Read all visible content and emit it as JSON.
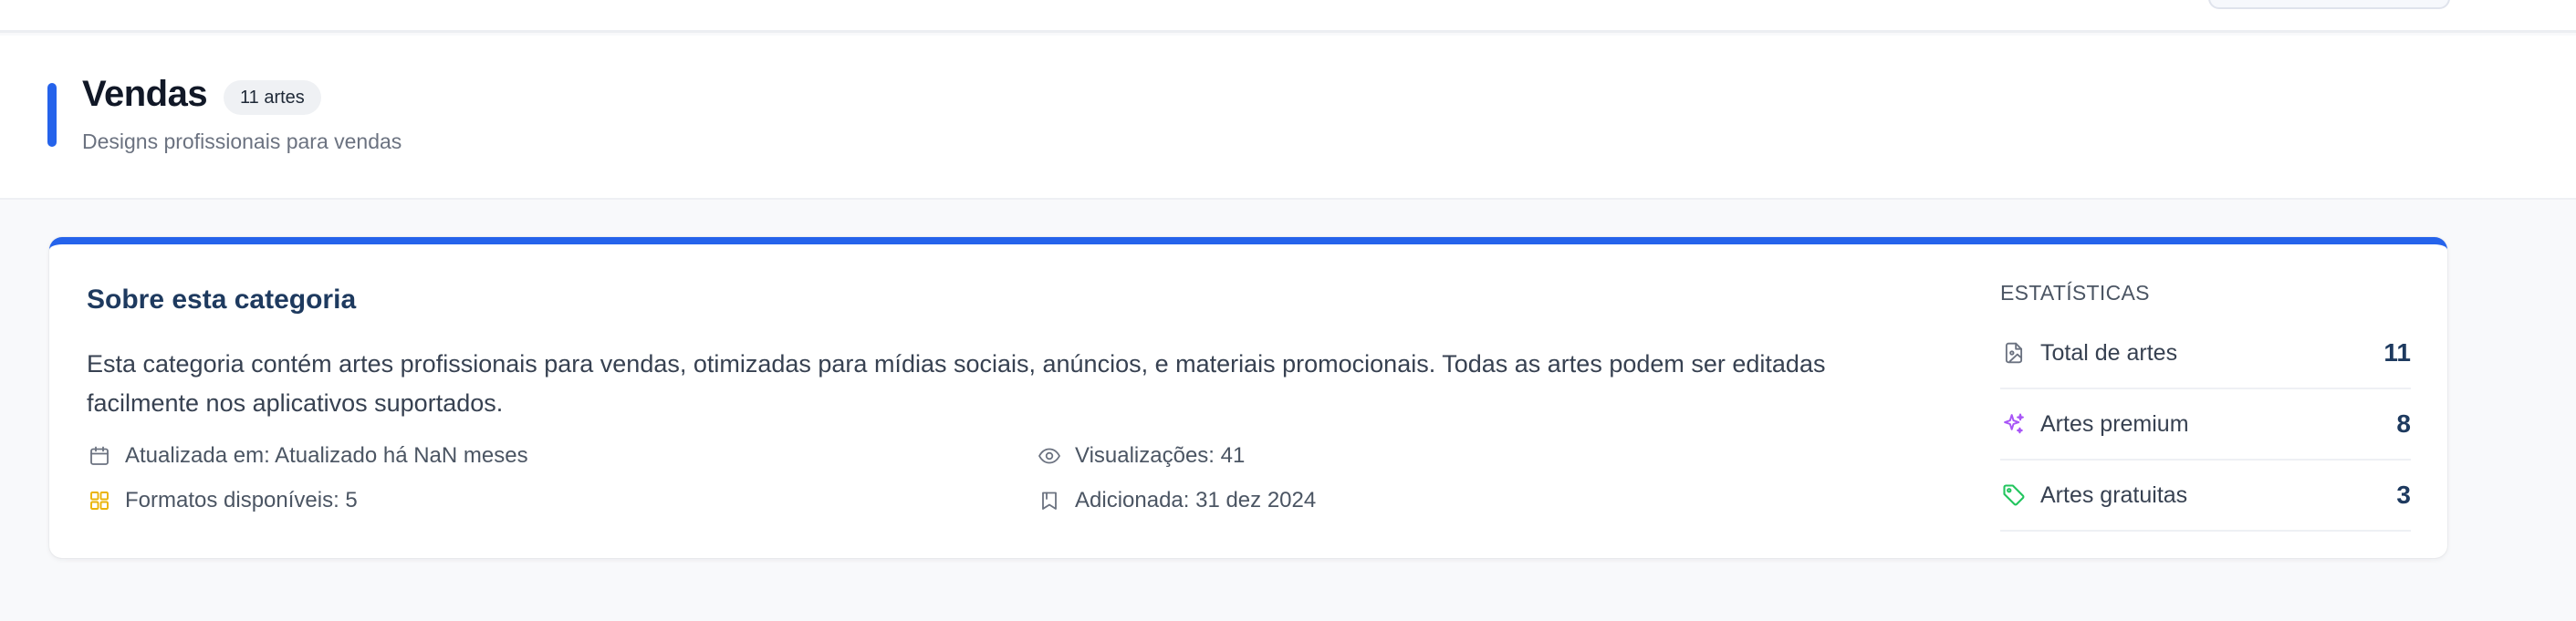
{
  "header": {
    "title": "Vendas",
    "badge": "11 artes",
    "subtitle": "Designs profissionais para vendas",
    "accent_color": "#2563eb"
  },
  "card": {
    "title": "Sobre esta categoria",
    "description": "Esta categoria contém artes profissionais para vendas, otimizadas para mídias sociais, anúncios, e materiais promocionais. Todas as artes podem ser editadas facilmente nos aplicativos suportados.",
    "meta": {
      "updated": "Atualizada em: Atualizado há NaN meses",
      "updated_icon": "calendar-icon",
      "formats": "Formatos disponíveis: 5",
      "formats_icon": "grid-icon",
      "views": "Visualizações: 41",
      "views_icon": "eye-icon",
      "added": "Adicionada: 31 dez 2024",
      "added_icon": "bookmark-icon"
    }
  },
  "stats": {
    "heading": "ESTATÍSTICAS",
    "items": [
      {
        "label": "Total de artes",
        "value": "11",
        "icon": "file-image-icon",
        "icon_color": "#6b7280"
      },
      {
        "label": "Artes premium",
        "value": "8",
        "icon": "sparkles-icon",
        "icon_color": "#a855f7"
      },
      {
        "label": "Artes gratuitas",
        "value": "3",
        "icon": "tag-icon",
        "icon_color": "#22c55e"
      }
    ]
  },
  "colors": {
    "accent": "#2563eb",
    "formats_icon": "#eab308",
    "premium_icon": "#a855f7",
    "free_icon": "#22c55e"
  }
}
